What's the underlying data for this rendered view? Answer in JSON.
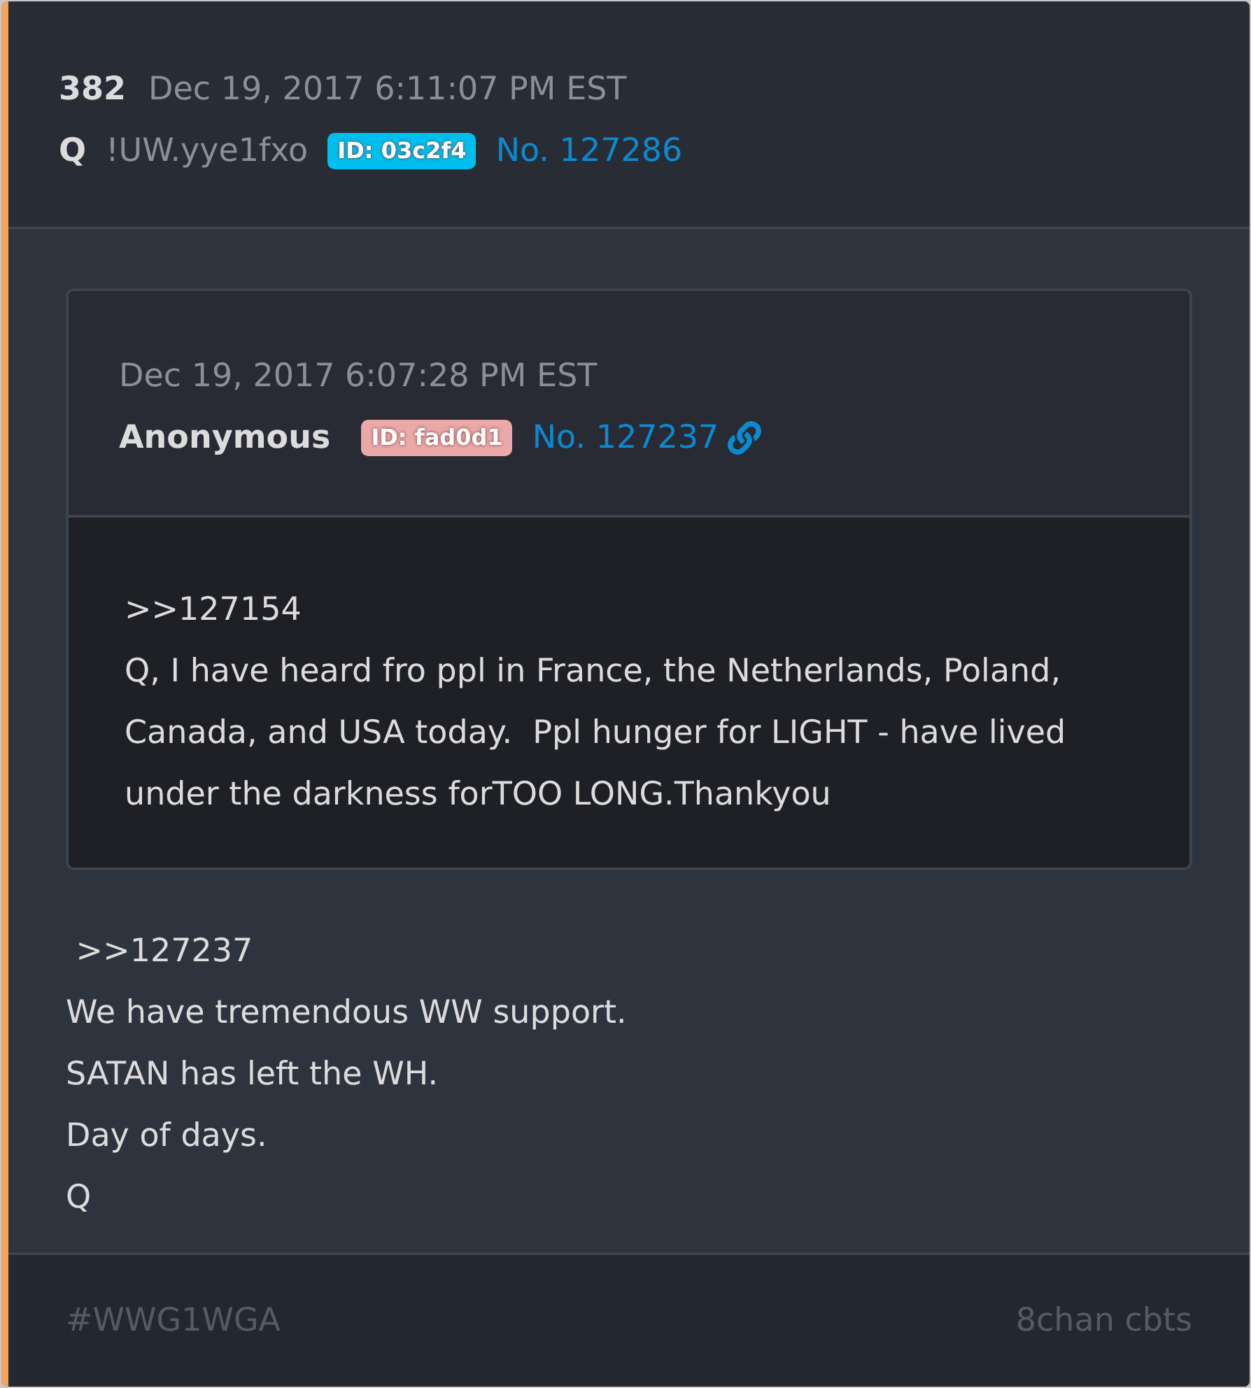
{
  "post": {
    "number": "382",
    "timestamp": "Dec 19, 2017 6:11:07 PM EST",
    "author": "Q",
    "tripcode": "!UW.yye1fxo",
    "id_badge": {
      "label": "ID: 03c2f4",
      "color": "#00bfef"
    },
    "post_no": "No. 127286"
  },
  "quoted_post": {
    "timestamp": "Dec 19, 2017 6:07:28 PM EST",
    "author": "Anonymous",
    "id_badge": {
      "label": "ID: fad0d1",
      "color": "#eba8a8"
    },
    "post_no": "No. 127237",
    "lines": [
      ">>127154",
      "Q, I have heard fro ppl in France, the Netherlands, Poland, Canada, and USA today.  Ppl hunger for LIGHT - have lived under the darkness forTOO LONG.Thankyou"
    ]
  },
  "message_lines": [
    " >>127237",
    "We have tremendous WW support.",
    "SATAN has left the WH.",
    "Day of days.",
    "Q"
  ],
  "footer": {
    "hashtag": "#WWG1WGA",
    "source": "8chan cbts"
  }
}
